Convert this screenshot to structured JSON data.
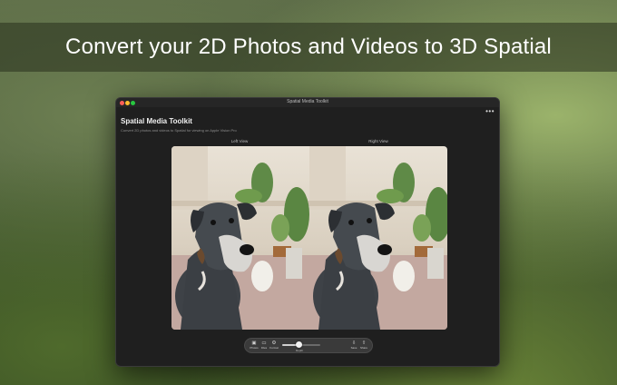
{
  "banner": {
    "title": "Convert your 2D Photos and Videos to 3D Spatial"
  },
  "window": {
    "title": "Spatial Media Toolkit",
    "more_icon": "ellipsis-icon",
    "app_title": "Spatial Media Toolkit",
    "app_subtitle": "Convert 2D photos and videos to Spatial for viewing on Apple Vision Pro",
    "left_view_label": "Left View",
    "right_view_label": "Right View"
  },
  "toolbar": {
    "photos": {
      "label": "Photos",
      "icon": "photo-icon"
    },
    "files": {
      "label": "Files",
      "icon": "folder-icon"
    },
    "format": {
      "label": "Format",
      "icon": "gear-icon"
    },
    "depth": {
      "label": "Depth",
      "value": 0.45
    },
    "save": {
      "label": "Save",
      "icon": "save-icon"
    },
    "share": {
      "label": "Share",
      "icon": "share-icon"
    }
  },
  "colors": {
    "accent": "#ffffff",
    "window_bg": "#1f1f1f",
    "toolbar_bg": "#3a3a3a"
  }
}
